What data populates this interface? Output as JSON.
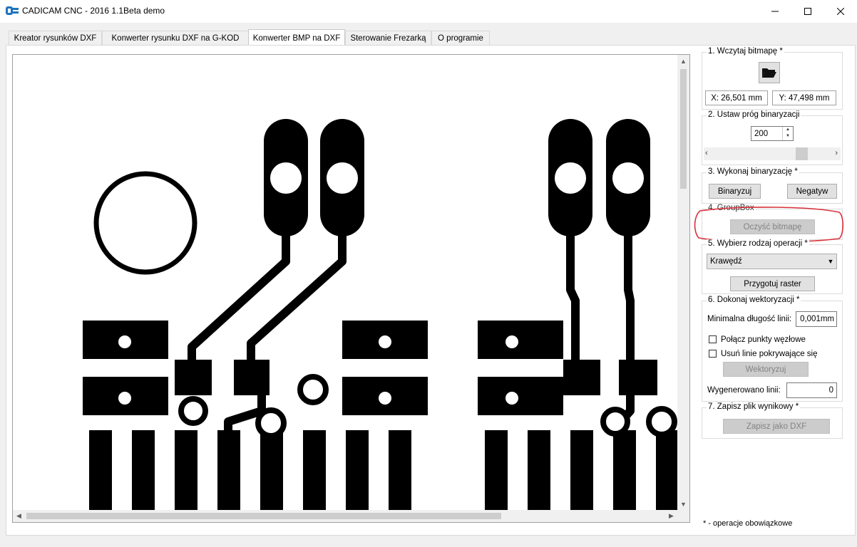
{
  "window": {
    "title": "CADICAM CNC - 2016 1.1Beta demo"
  },
  "tabs": [
    {
      "label": "Kreator rysunków DXF"
    },
    {
      "label": "Konwerter rysunku DXF na G-KOD"
    },
    {
      "label": "Konwerter BMP na DXF",
      "active": true
    },
    {
      "label": "Sterowanie Frezarką"
    },
    {
      "label": "O programie"
    }
  ],
  "panel": {
    "g1": {
      "title": "1. Wczytaj bitmapę *",
      "coord_x": "X: 26,501 mm",
      "coord_y": "Y: 47,498 mm"
    },
    "g2": {
      "title": "2. Ustaw próg binaryzacji",
      "threshold": "200"
    },
    "g3": {
      "title": "3. Wykonaj binaryzację *",
      "binarize": "Binaryzuj",
      "negative": "Negatyw"
    },
    "g4": {
      "title": "4. GroupBox",
      "clear": "Oczyść bitmapę"
    },
    "g5": {
      "title": "5. Wybierz rodzaj operacji *",
      "operation": "Krawędź",
      "prepare": "Przygotuj raster"
    },
    "g6": {
      "title": "6. Dokonaj wektoryzacji *",
      "min_len_label": "Minimalna długość linii:",
      "min_len": "0,001mm",
      "join_label": "Połącz punkty węzłowe",
      "remove_label": "Usuń linie pokrywające się",
      "vectorize": "Wektoryzuj",
      "generated_label": "Wygenerowano linii:",
      "generated": "0"
    },
    "g7": {
      "title": "7. Zapisz plik wynikowy *",
      "save": "Zapisz jako DXF"
    },
    "footnote": "* - operacje obowiązkowe"
  },
  "colors": {
    "annotation": "#d9303a",
    "trace": "#000000"
  }
}
